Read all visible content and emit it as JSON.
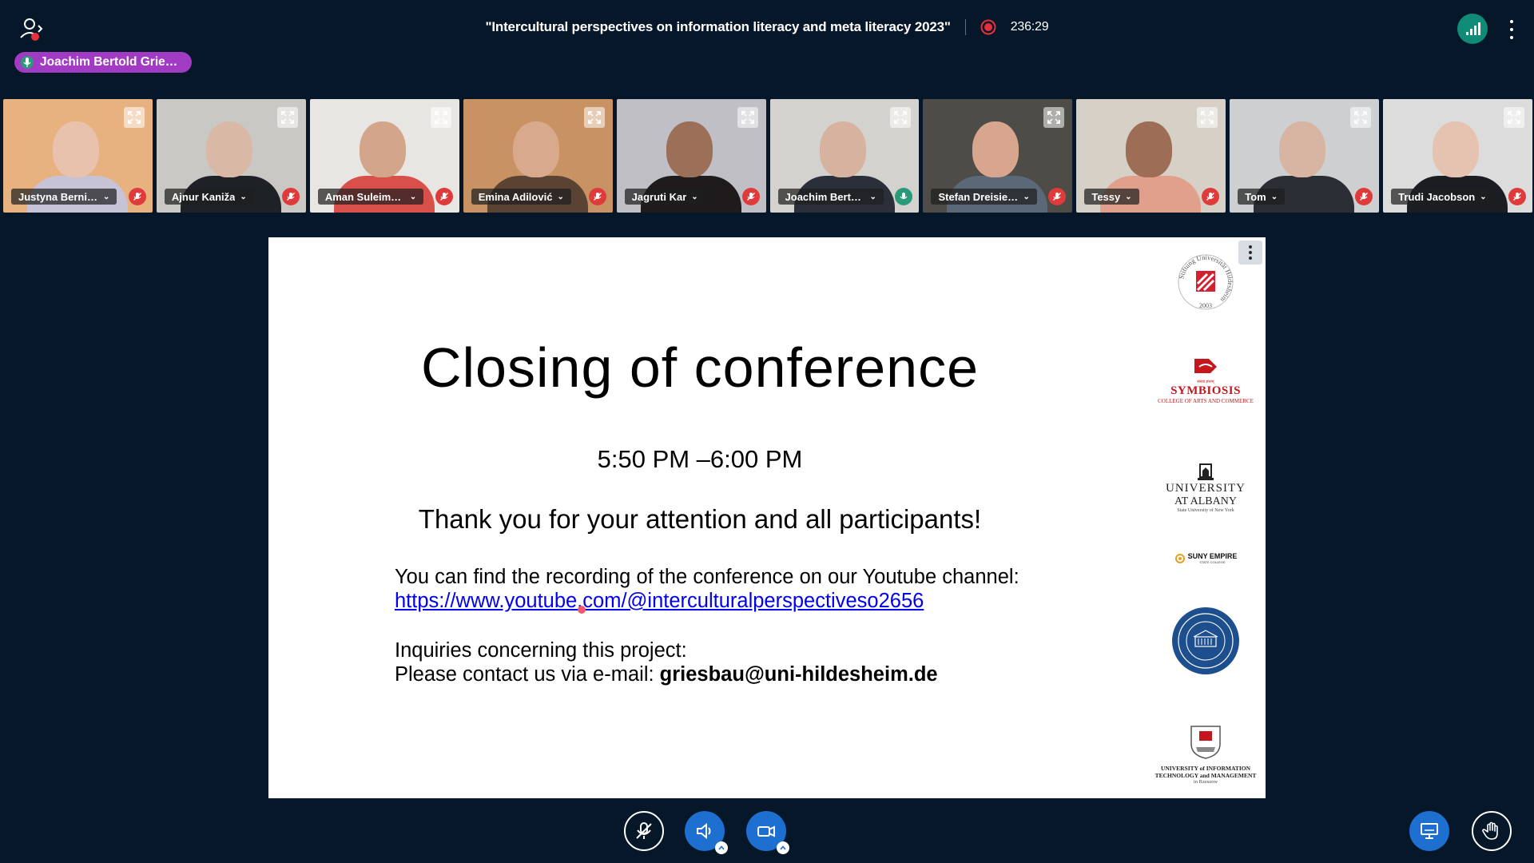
{
  "meeting": {
    "title": "\"Intercultural perspectives on information literacy and meta literacy 2023\"",
    "recording_time": "236:29",
    "talking_indicator": "Joachim Bertold Grie…"
  },
  "participants": [
    {
      "name": "Justyna Bernia…",
      "muted": true,
      "active": false,
      "bg": "#e8b280",
      "skin": "#e8c2ac",
      "body_color": "#c7c3d6"
    },
    {
      "name": "Ajnur Kaniža",
      "muted": true,
      "active": false,
      "bg": "#c9c8c4",
      "skin": "#d9b9a6",
      "body_color": "#1e2227"
    },
    {
      "name": "Aman Suleime…",
      "muted": true,
      "active": false,
      "bg": "#e8e6e3",
      "skin": "#d3a58a",
      "body_color": "#d9504b"
    },
    {
      "name": "Emina Adilović",
      "muted": true,
      "active": false,
      "bg": "#c99263",
      "skin": "#d8a98c",
      "body_color": "#5a4333"
    },
    {
      "name": "Jagruti Kar",
      "muted": true,
      "active": false,
      "bg": "#bfbfc5",
      "skin": "#9b6f58",
      "body_color": "#1f1a1c"
    },
    {
      "name": "Joachim Bertol…",
      "muted": false,
      "active": true,
      "bg": "#d4d2cf",
      "skin": "#d7b29e",
      "body_color": "#2a2f3a"
    },
    {
      "name": "Stefan Dreisieb…",
      "muted": true,
      "active": false,
      "bg": "#4d4c46",
      "skin": "#d8a58e",
      "body_color": "#5b6878"
    },
    {
      "name": "Tessy",
      "muted": true,
      "active": false,
      "bg": "#d6d0c6",
      "skin": "#9d6d55",
      "body_color": "#e0a08c"
    },
    {
      "name": "Tom",
      "muted": true,
      "active": false,
      "bg": "#cdcfd1",
      "skin": "#d8b5a3",
      "body_color": "#2a2d33"
    },
    {
      "name": "Trudi Jacobson",
      "muted": true,
      "active": false,
      "bg": "#dcdcdc",
      "skin": "#e6c3b0",
      "body_color": "#1c1d22"
    }
  ],
  "slide": {
    "title": "Closing of conference",
    "time": "5:50 PM –6:00 PM",
    "thanks": "Thank you for your attention and all participants!",
    "recording_line": "You can find the recording of the conference on our Youtube channel:",
    "youtube_link": "https://www.youtube.com/@interculturalperspectiveso2656",
    "inquiries_line": "Inquiries concerning this project:",
    "contact_prefix": "Please contact us via e-mail: ",
    "contact_email": "griesbau@uni-hildesheim.de",
    "logos": {
      "hildesheim_ring": "Stiftung Universität Hildesheim",
      "hildesheim_year": "2003",
      "symbiosis_small": "संस्था ज्ञानम्",
      "symbiosis_name": "SYMBIOSIS",
      "symbiosis_sub": "COLLEGE OF ARTS AND COMMERCE",
      "albany_line1": "UNIVERSITY",
      "albany_line2": "AT ALBANY",
      "albany_line3": "State University of New York",
      "suny_line1": "SUNY EMPIRE",
      "suny_line2": "STATE COLLEGE",
      "uitm_line1": "UNIVERSITY of INFORMATION",
      "uitm_line2": "TECHNOLOGY and MANAGEMENT",
      "uitm_line3": "in Rzeszow"
    }
  },
  "colors": {
    "background": "#06172a",
    "accent_blue": "#1d6fd0",
    "mute_red": "#e03b3b",
    "talking_purple": "#a13bc4",
    "symbiosis_red": "#c4161c",
    "sarajevo_blue": "#1d4f8f"
  },
  "icons": {
    "users": "users-icon",
    "recording": "record-icon",
    "connection": "signal-bars-icon",
    "mic_off": "mic-off-icon",
    "speaker": "speaker-icon",
    "camera": "camera-icon",
    "screen_share": "screen-share-icon",
    "raise_hand": "hand-icon"
  }
}
